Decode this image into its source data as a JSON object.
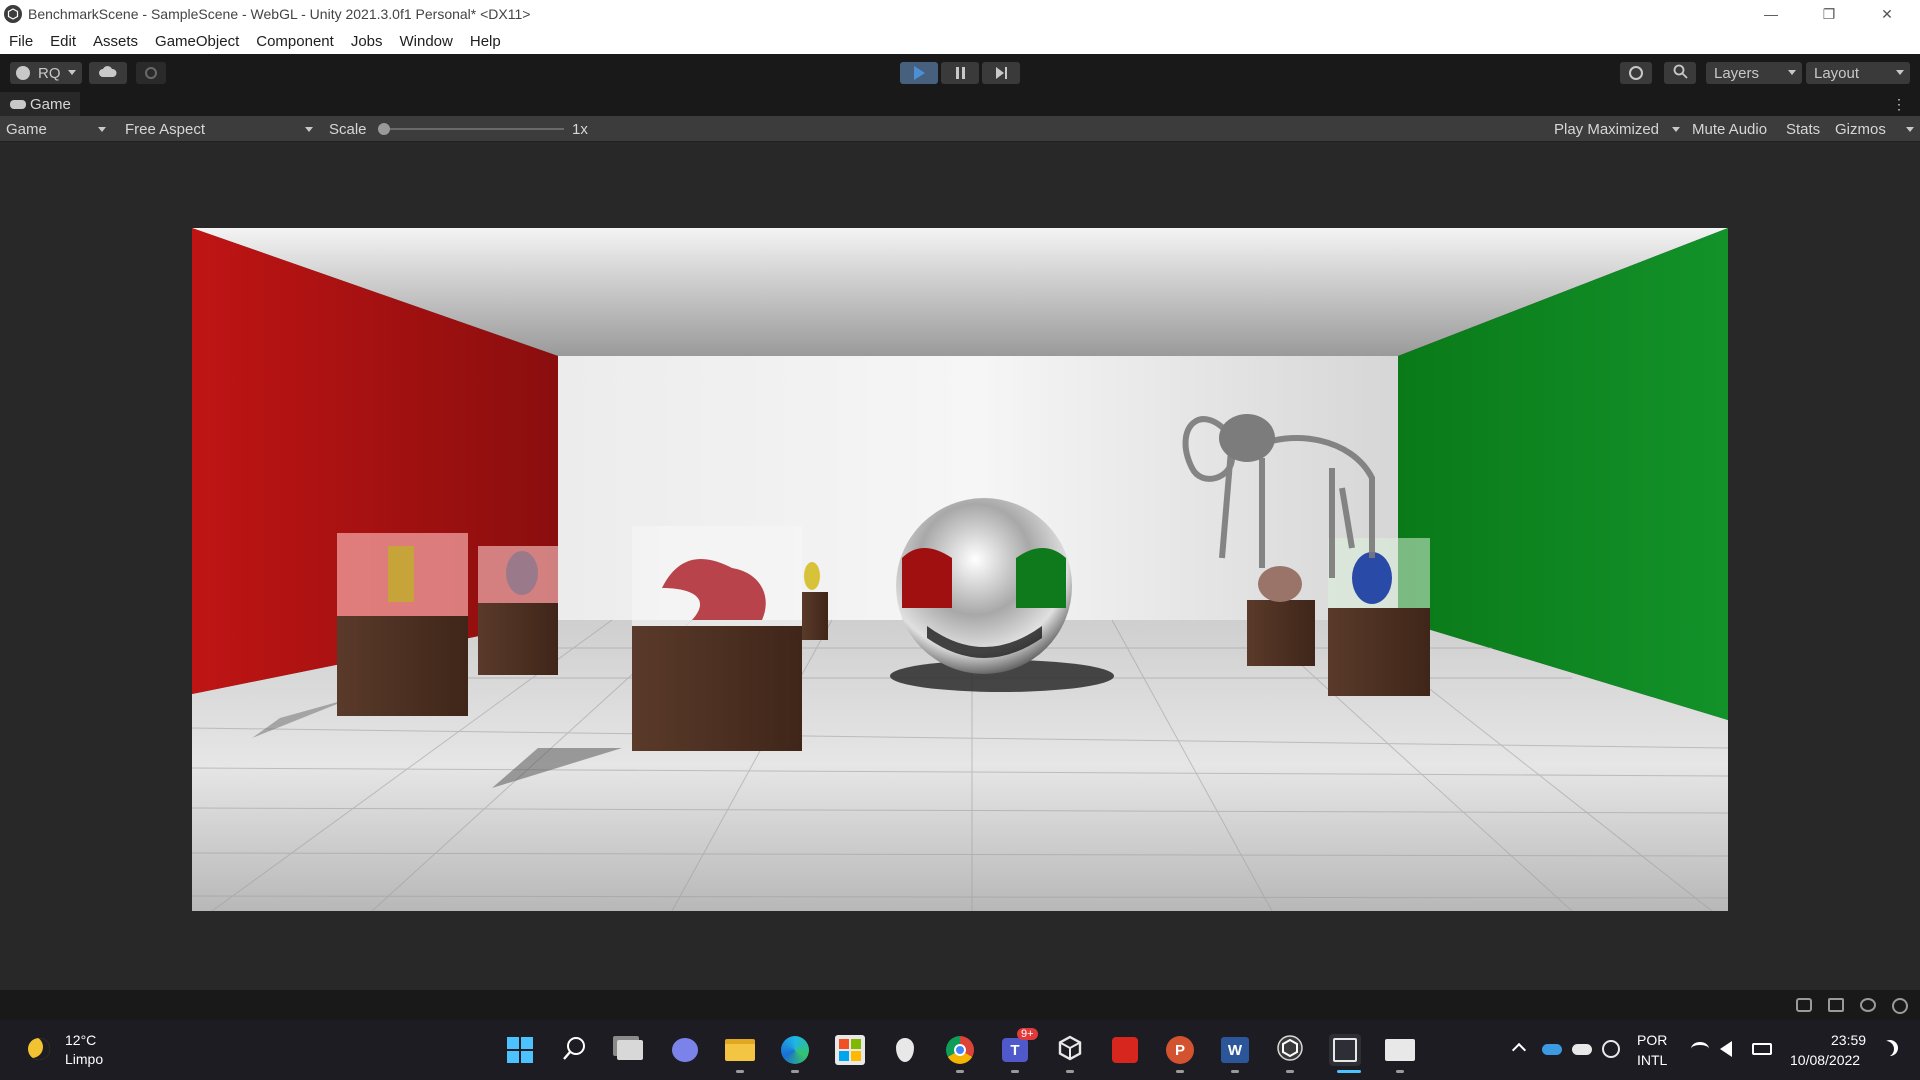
{
  "window": {
    "title": "BenchmarkScene - SampleScene - WebGL - Unity 2021.3.0f1 Personal* <DX11>",
    "minimize": "—",
    "maximize": "❐",
    "close": "✕"
  },
  "menu": [
    "File",
    "Edit",
    "Assets",
    "GameObject",
    "Component",
    "Jobs",
    "Window",
    "Help"
  ],
  "toolbar": {
    "account_label": "RQ",
    "layers_label": "Layers",
    "layout_label": "Layout"
  },
  "game_tab": {
    "label": "Game",
    "display_select": "Game",
    "aspect_select": "Free Aspect",
    "scale_label": "Scale",
    "scale_value": "1x",
    "play_maximized": "Play Maximized",
    "mute_audio": "Mute Audio",
    "stats": "Stats",
    "gizmos": "Gizmos"
  },
  "weather": {
    "temperature": "12°C",
    "condition": "Limpo"
  },
  "taskbar": {
    "teams_badge": "9+",
    "language_line1": "POR",
    "language_line2": "INTL",
    "time": "23:59",
    "date": "10/08/2022"
  },
  "colors": {
    "title_bg": "#ffffff",
    "editor_dark": "#191919",
    "panel": "#282828",
    "toolbar_control": "#3c3c3c",
    "play_active": "#4d8fd6",
    "taskbar_bg": "#1c1c22",
    "wall_red": "#b01515",
    "wall_green": "#0e8a1c"
  }
}
